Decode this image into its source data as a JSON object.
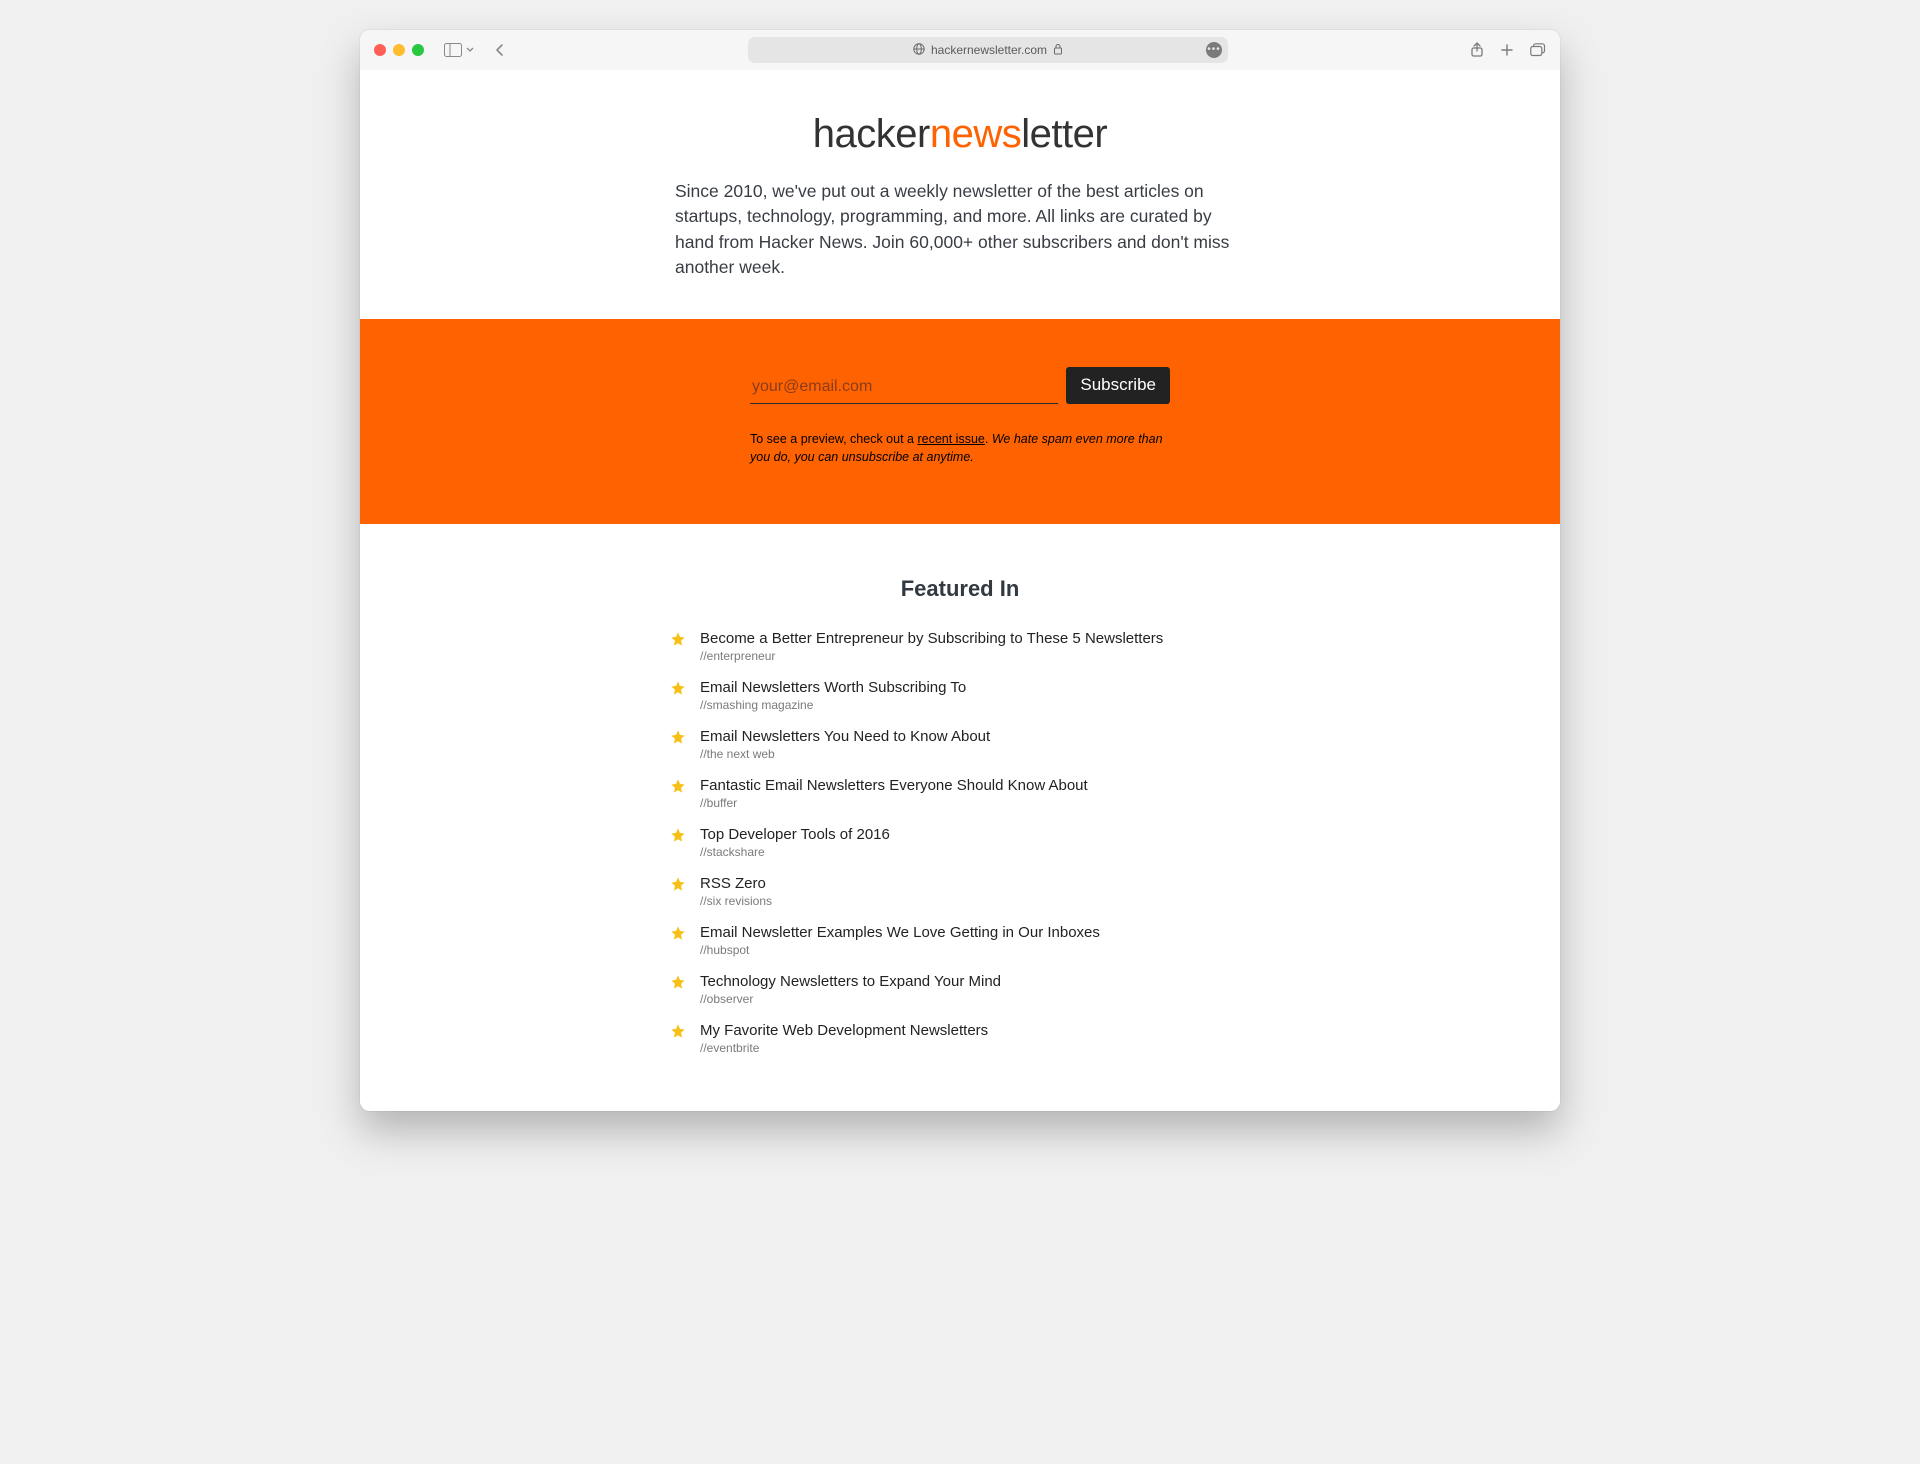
{
  "browser": {
    "url": "hackernewsletter.com"
  },
  "logo": {
    "part1": "hacker",
    "part2": "news",
    "part3": "letter"
  },
  "intro": "Since 2010, we've put out a weekly newsletter of the best articles on startups, technology, programming, and more. All links are curated by hand from Hacker News. Join 60,000+ other subscribers and don't miss another week.",
  "subscribe": {
    "email_placeholder": "your@email.com",
    "button_label": "Subscribe",
    "preview_prefix": "To see a preview, check out a ",
    "preview_link": "recent issue",
    "preview_suffix": ". ",
    "spam_note": "We hate spam even more than you do, you can unsubscribe at anytime."
  },
  "featured": {
    "heading": "Featured In",
    "items": [
      {
        "title": "Become a Better Entrepreneur by Subscribing to These 5 Newsletters",
        "source": "//enterpreneur"
      },
      {
        "title": "Email Newsletters Worth Subscribing To",
        "source": "//smashing magazine"
      },
      {
        "title": "Email Newsletters You Need to Know About",
        "source": "//the next web"
      },
      {
        "title": "Fantastic Email Newsletters Everyone Should Know About",
        "source": "//buffer"
      },
      {
        "title": "Top Developer Tools of 2016",
        "source": "//stackshare"
      },
      {
        "title": "RSS Zero",
        "source": "//six revisions"
      },
      {
        "title": "Email Newsletter Examples We Love Getting in Our Inboxes",
        "source": "//hubspot"
      },
      {
        "title": "Technology Newsletters to Expand Your Mind",
        "source": "//observer"
      },
      {
        "title": "My Favorite Web Development Newsletters",
        "source": "//eventbrite"
      }
    ]
  }
}
